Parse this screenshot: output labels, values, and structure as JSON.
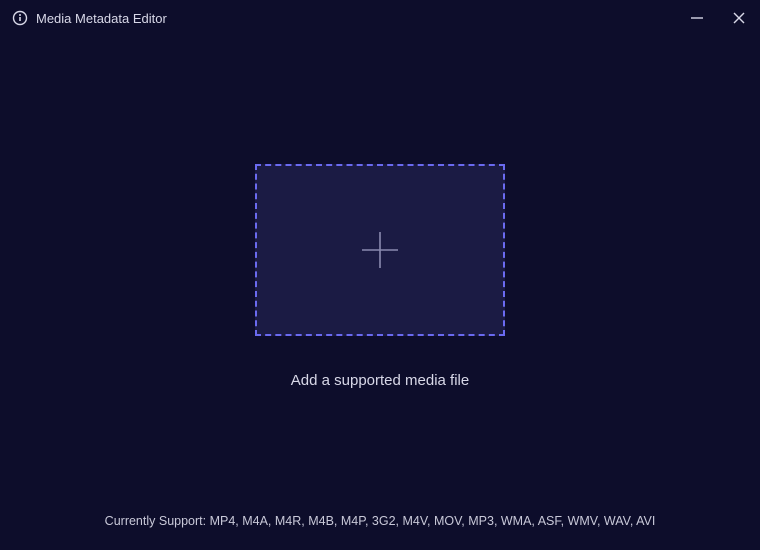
{
  "titlebar": {
    "app_title": "Media Metadata Editor"
  },
  "main": {
    "instruction": "Add a supported media file"
  },
  "footer": {
    "support_text": "Currently Support: MP4, M4A, M4R, M4B, M4P, 3G2, M4V, MOV, MP3, WMA, ASF, WMV, WAV, AVI"
  }
}
